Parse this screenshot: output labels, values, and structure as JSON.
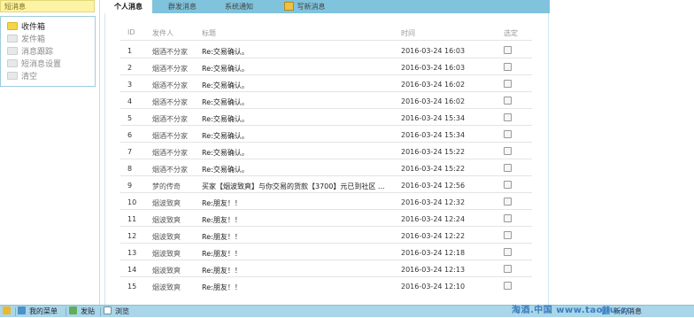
{
  "sidebar": {
    "header": "短消息",
    "items": [
      {
        "label": "收件箱",
        "active": true
      },
      {
        "label": "发件箱",
        "active": false
      },
      {
        "label": "消息跟踪",
        "active": false
      },
      {
        "label": "短消息设置",
        "active": false
      },
      {
        "label": "清空",
        "active": false
      }
    ]
  },
  "tabs": [
    {
      "label": "个人消息"
    },
    {
      "label": "群发消息"
    },
    {
      "label": "系统通知"
    },
    {
      "label": "写新消息"
    }
  ],
  "table": {
    "headers": {
      "id": "ID",
      "sender": "发件人",
      "title": "标题",
      "time": "时间",
      "select": "选定"
    },
    "rows": [
      {
        "id": "1",
        "sender": "烟酒不分家",
        "title": "Re:交易确认。",
        "time": "2016-03-24 16:03"
      },
      {
        "id": "2",
        "sender": "烟酒不分家",
        "title": "Re:交易确认。",
        "time": "2016-03-24 16:03"
      },
      {
        "id": "3",
        "sender": "烟酒不分家",
        "title": "Re:交易确认。",
        "time": "2016-03-24 16:02"
      },
      {
        "id": "4",
        "sender": "烟酒不分家",
        "title": "Re:交易确认。",
        "time": "2016-03-24 16:02"
      },
      {
        "id": "5",
        "sender": "烟酒不分家",
        "title": "Re:交易确认。",
        "time": "2016-03-24 15:34"
      },
      {
        "id": "6",
        "sender": "烟酒不分家",
        "title": "Re:交易确认。",
        "time": "2016-03-24 15:34"
      },
      {
        "id": "7",
        "sender": "烟酒不分家",
        "title": "Re:交易确认。",
        "time": "2016-03-24 15:22"
      },
      {
        "id": "8",
        "sender": "烟酒不分家",
        "title": "Re:交易确认。",
        "time": "2016-03-24 15:22"
      },
      {
        "id": "9",
        "sender": "梦的传奇",
        "title": "买家【烟波致爽】与你交易的货款【3700】元已到社区 ...",
        "time": "2016-03-24 12:56"
      },
      {
        "id": "10",
        "sender": "烟波致爽",
        "title": "Re:朋友！！",
        "time": "2016-03-24 12:32"
      },
      {
        "id": "11",
        "sender": "烟波致爽",
        "title": "Re:朋友！！",
        "time": "2016-03-24 12:24"
      },
      {
        "id": "12",
        "sender": "烟波致爽",
        "title": "Re:朋友！！",
        "time": "2016-03-24 12:22"
      },
      {
        "id": "13",
        "sender": "烟波致爽",
        "title": "Re:朋友！！",
        "time": "2016-03-24 12:18"
      },
      {
        "id": "14",
        "sender": "烟波致爽",
        "title": "Re:朋友！！",
        "time": "2016-03-24 12:13"
      },
      {
        "id": "15",
        "sender": "烟波致爽",
        "title": "Re:朋友！！",
        "time": "2016-03-24 12:10"
      }
    ]
  },
  "bottombar": {
    "menu": "我的菜单",
    "post": "发贴",
    "browse": "浏览",
    "new_msg": "新的消息",
    "watermark": "淘酒.中国 www.taojiu.cc"
  },
  "colors": {
    "tabbar": "#7fc3dc",
    "sidebar_header": "#fdf3a5",
    "bottombar": "#a9d6e8"
  }
}
